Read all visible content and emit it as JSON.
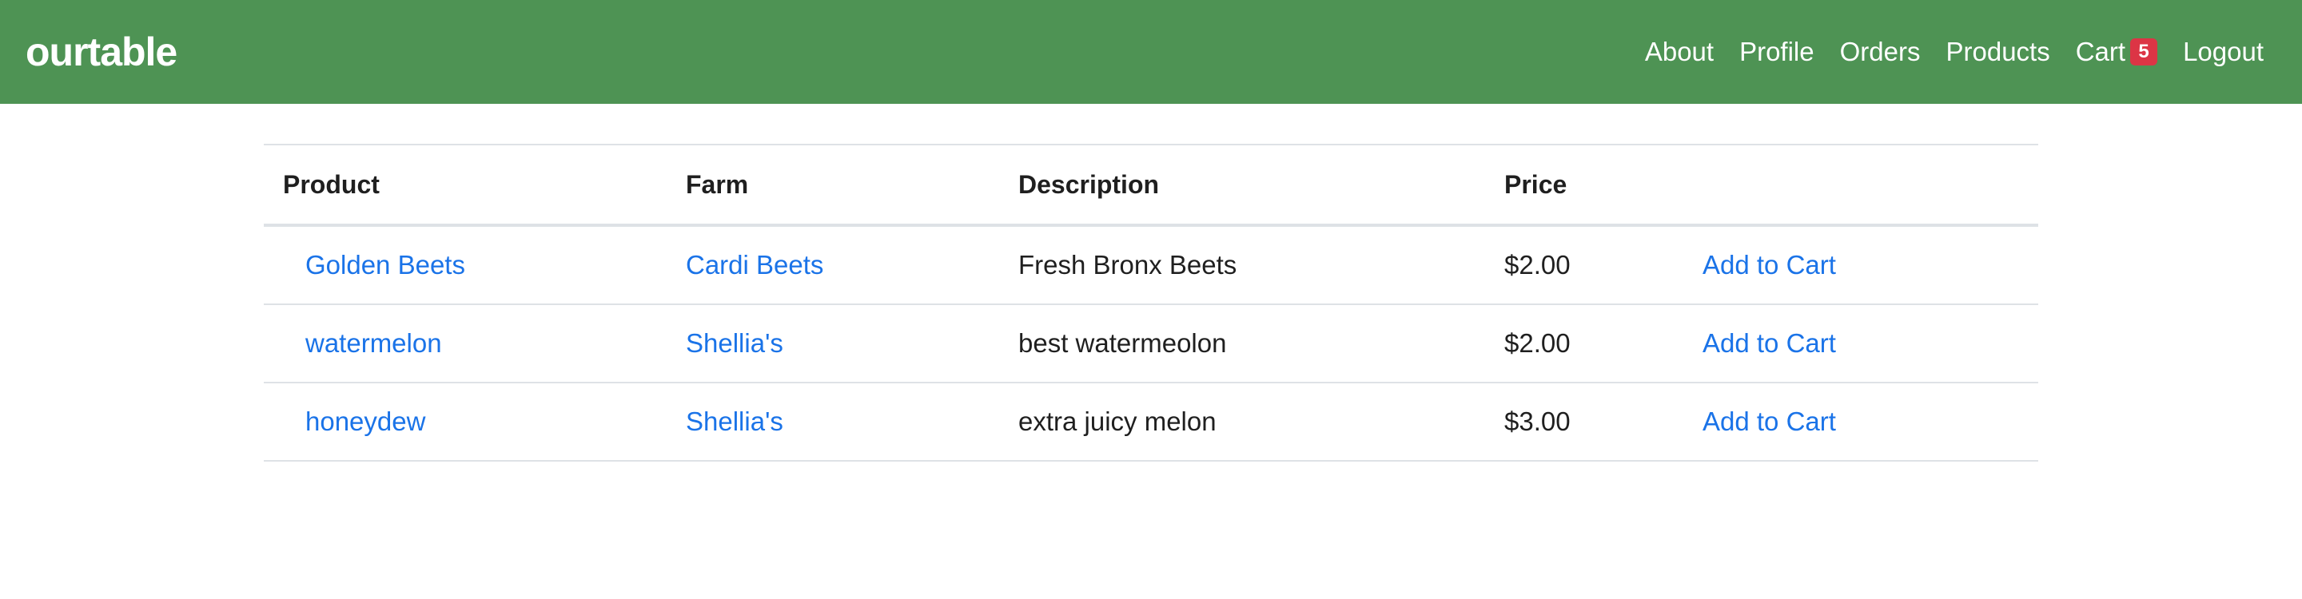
{
  "nav": {
    "brand": "ourtable",
    "links": [
      {
        "label": "About"
      },
      {
        "label": "Profile"
      },
      {
        "label": "Orders"
      },
      {
        "label": "Products"
      }
    ],
    "cart_label": "Cart",
    "cart_count": "5",
    "logout_label": "Logout"
  },
  "table": {
    "headers": [
      "Product",
      "Farm",
      "Description",
      "Price",
      ""
    ],
    "rows": [
      {
        "product": "Golden Beets",
        "farm": "Cardi Beets",
        "description": "Fresh Bronx Beets",
        "price": "$2.00",
        "action": "Add to Cart"
      },
      {
        "product": "watermelon",
        "farm": "Shellia's",
        "description": "best watermeolon",
        "price": "$2.00",
        "action": "Add to Cart"
      },
      {
        "product": "honeydew",
        "farm": "Shellia's",
        "description": "extra juicy melon",
        "price": "$3.00",
        "action": "Add to Cart"
      }
    ]
  },
  "colors": {
    "navbar": "#4e9354",
    "link": "#1a73e8",
    "badge": "#dc3545"
  }
}
